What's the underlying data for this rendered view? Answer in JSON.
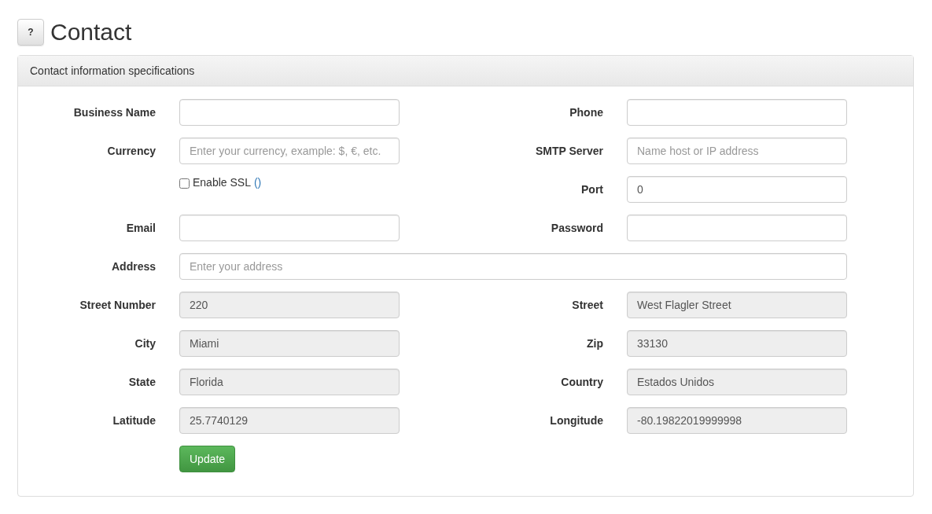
{
  "header": {
    "help_button": "?",
    "title": "Contact"
  },
  "panel": {
    "heading": "Contact information specifications",
    "rows": [
      {
        "cells": [
          {
            "kind": "field",
            "label": "Business Name",
            "disabled": false
          },
          {
            "kind": "field",
            "label": "Phone",
            "disabled": false
          }
        ]
      },
      {
        "cells": [
          {
            "kind": "field",
            "label": "Currency",
            "placeholder": "Enter your currency, example: $, €, etc.",
            "disabled": false
          },
          {
            "kind": "field",
            "label": "SMTP Server",
            "placeholder": "Name host or IP address",
            "disabled": false
          }
        ]
      },
      {
        "cells": [
          {
            "kind": "checkbox",
            "label": "Enable SSL",
            "link": "()",
            "checked": false
          },
          {
            "kind": "field",
            "label": "Port",
            "value": "0",
            "disabled": false
          }
        ]
      },
      {
        "cells": [
          {
            "kind": "field",
            "label": "Email",
            "disabled": false
          },
          {
            "kind": "field",
            "label": "Password",
            "disabled": false
          }
        ]
      },
      {
        "cells": [
          {
            "kind": "wide",
            "label": "Address",
            "placeholder": "Enter your address",
            "disabled": false
          }
        ]
      },
      {
        "cells": [
          {
            "kind": "field",
            "label": "Street Number",
            "value": "220",
            "disabled": true
          },
          {
            "kind": "field",
            "label": "Street",
            "value": "West Flagler Street",
            "disabled": true
          }
        ]
      },
      {
        "cells": [
          {
            "kind": "field",
            "label": "City",
            "value": "Miami",
            "disabled": true
          },
          {
            "kind": "field",
            "label": "Zip",
            "value": "33130",
            "disabled": true
          }
        ]
      },
      {
        "cells": [
          {
            "kind": "field",
            "label": "State",
            "value": "Florida",
            "disabled": true
          },
          {
            "kind": "field",
            "label": "Country",
            "value": "Estados Unidos",
            "disabled": true
          }
        ]
      },
      {
        "cells": [
          {
            "kind": "field",
            "label": "Latitude",
            "value": "25.7740129",
            "disabled": true
          },
          {
            "kind": "field",
            "label": "Longitude",
            "value": "-80.19822019999998",
            "disabled": true
          }
        ]
      }
    ],
    "submit_button": "Update"
  }
}
